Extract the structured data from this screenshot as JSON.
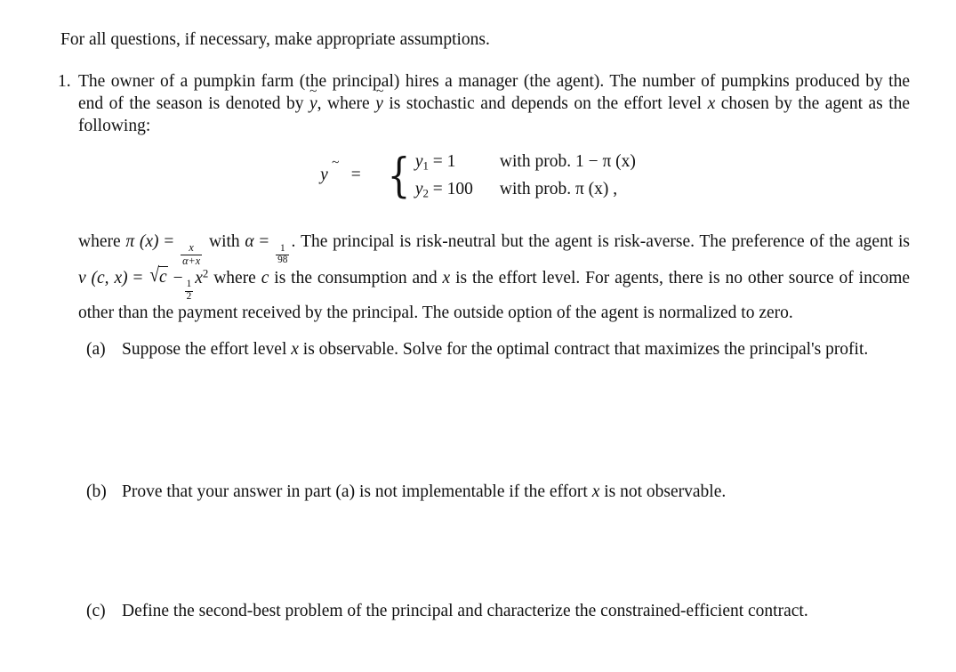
{
  "document": {
    "intro": "For all questions, if necessary, make appropriate assumptions.",
    "question": {
      "marker": "1.",
      "para_1a": "The owner of a pumpkin farm (the principal) hires a manager (the agent). The number of pumpkins",
      "para_1b": "produced by the end of the season is denoted by",
      "para_1c": ", where",
      "para_1d": "is stochastic and depends on the effort",
      "para_1e": "level",
      "para_1f": "chosen by the agent as the following:"
    },
    "equation": {
      "lhs": "ỹ",
      "relation": "=",
      "case_1_left": "y₁ = 1",
      "case_1_right": "with prob. 1 − π (x)",
      "case_2_left": "y₂ = 100",
      "case_2_right": "with prob. π (x) ,",
      "case_1_var": "y",
      "case_1_sub": "1",
      "case_1_value": "1",
      "case_2_var": "y",
      "case_2_sub": "2",
      "case_2_value": "100",
      "prob_label": "with prob.",
      "prob_1": "1 − π (x)",
      "prob_2": "π (x) ,",
      "brace": "{"
    },
    "where_paragraph": {
      "t1": "where",
      "pi_of_x": "π (x)",
      "eq1": "=",
      "frac_pi_num": "x",
      "frac_pi_den": "α+x",
      "t2": "with",
      "alpha": "α",
      "eq2": "=",
      "frac_alpha_num": "1",
      "frac_alpha_den": "98",
      "t3": ". The principal is risk-neutral but the agent is risk-averse. The preference of the agent is",
      "v_of_cx": "v (c, x)",
      "eq3": "=",
      "sqrt_c": "√c",
      "minus": "−",
      "half_num": "1",
      "half_den": "2",
      "x_squared": "x²",
      "t4": "where",
      "c_var": "c",
      "t5": "is the consumption and",
      "x_var": "x",
      "t6": "is the effort level. For agents, there is no other source of income other than the payment received by the principal. The outside option of the agent is normalized to zero."
    },
    "subquestions": [
      {
        "marker": "(a)",
        "text_1": "Suppose the effort level",
        "var": "x",
        "text_2": "is observable. Solve for the optimal contract that maximizes the principal's profit."
      },
      {
        "marker": "(b)",
        "text_1": "Prove that your answer in part (a) is not implementable if the effort",
        "var": "x",
        "text_2": "is not observable."
      },
      {
        "marker": "(c)",
        "text_1": "Define the second-best problem of the principal and characterize the constrained-efficient contract.",
        "var": "",
        "text_2": ""
      }
    ]
  },
  "colors": {
    "background": "#ffffff",
    "text": "#111111"
  }
}
